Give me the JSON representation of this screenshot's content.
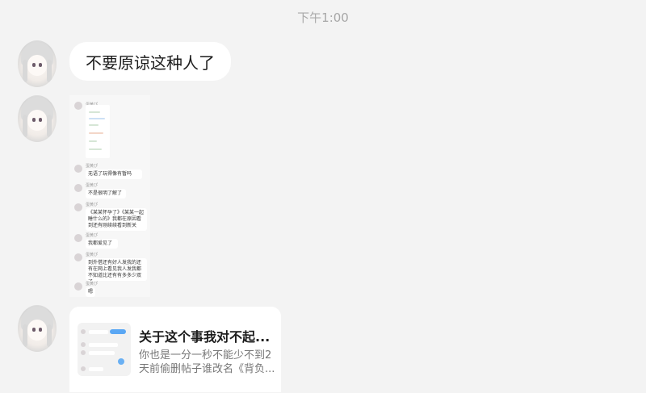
{
  "timestamp": "下午1:00",
  "messages": {
    "text_message": "不要原谅这种人了",
    "screenshot": {
      "sender": "蛋黄ぴ",
      "lines": [
        "无语了玩得像有暂吗",
        "不是很明了解了",
        "《某某怀孕了》《某某一起睡什么的》我都在原因看到还有刚续续看到新关",
        "我都爱见了",
        "到外借还有好人发我的还有在网上看见我人发我都不知道比还有有多多少双了",
        "嗯"
      ]
    },
    "card": {
      "title": "关于这个事我对不起...",
      "description": "你也是一分一秒不能少不到2天前偷删帖子谁改名《背负..."
    }
  },
  "colors": {
    "background": "#f3f3f3",
    "bubble": "#ffffff",
    "timestamp": "#a8a8a8",
    "accent_blue": "#5aa7f4"
  }
}
